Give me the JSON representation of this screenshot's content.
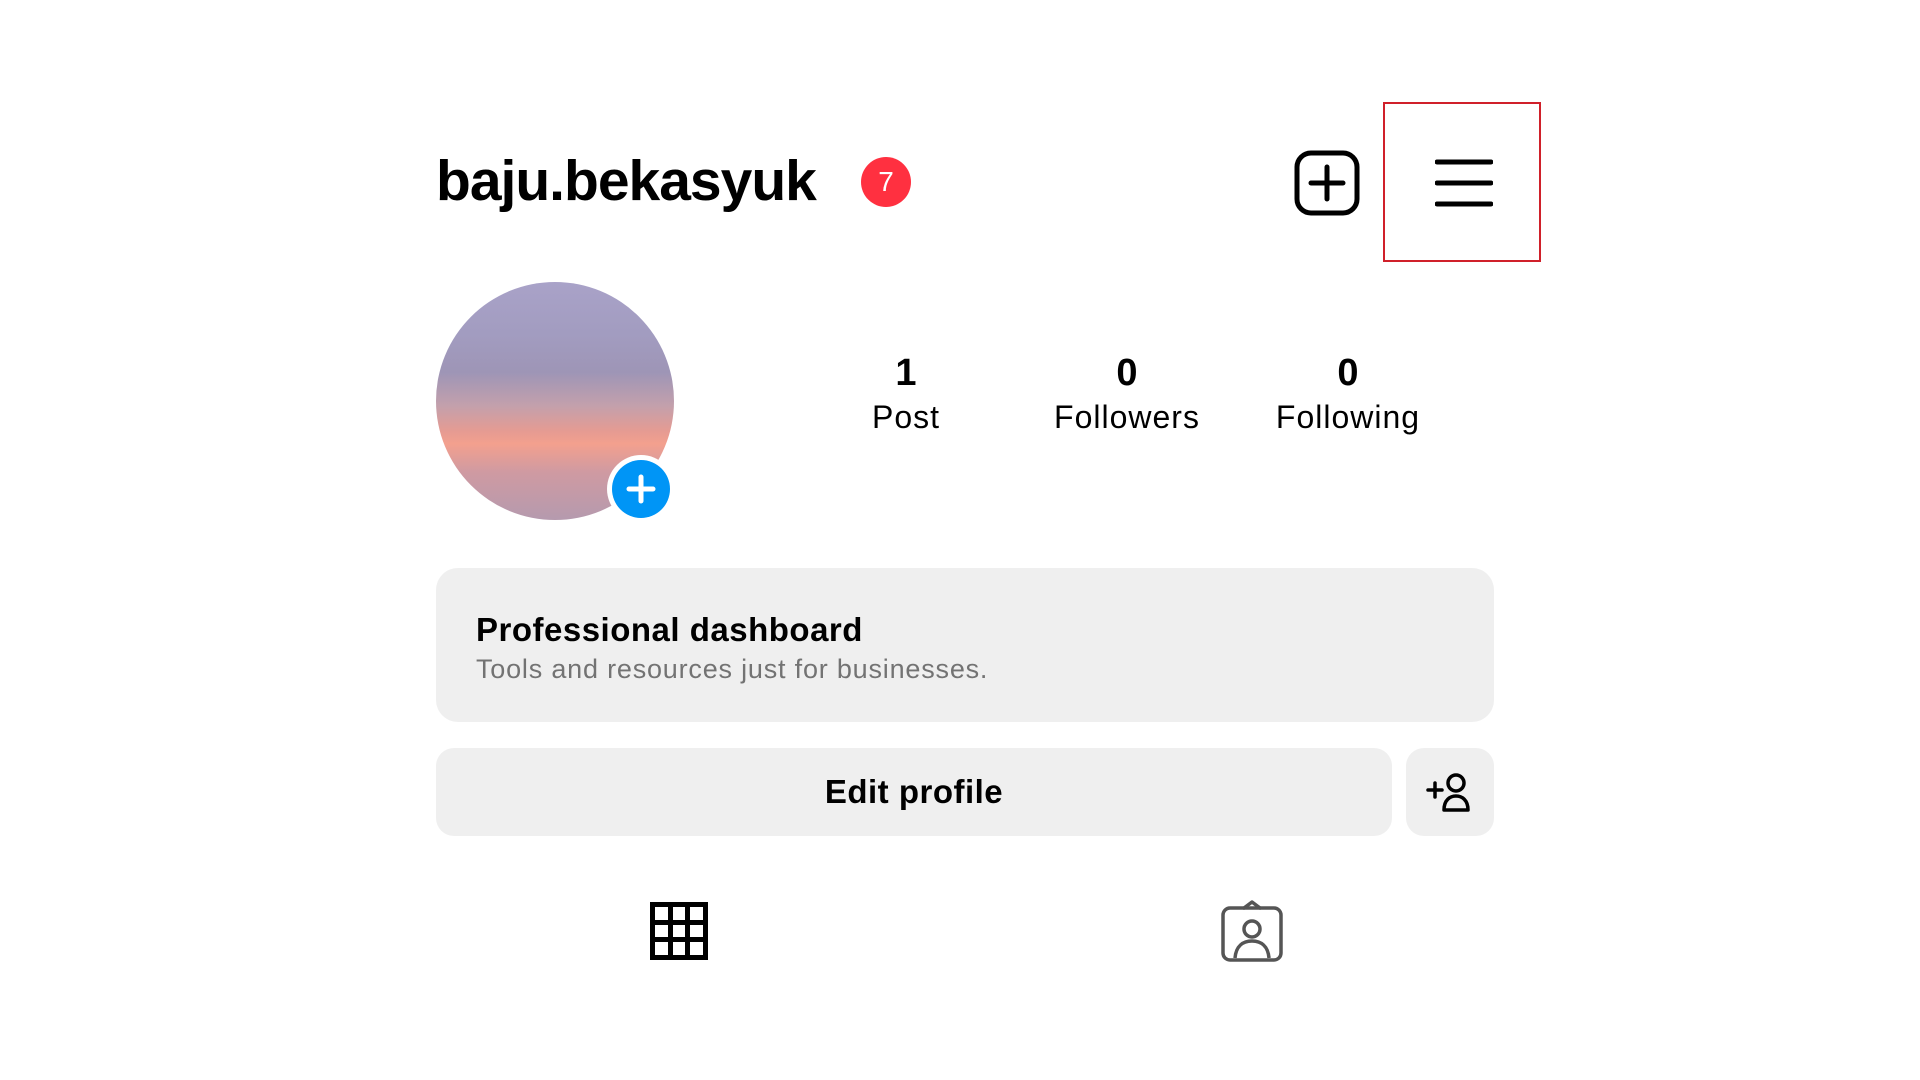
{
  "header": {
    "username": "baju.bekasyuk",
    "notification_count": "7",
    "create_icon": "plus-square-icon",
    "menu_icon": "hamburger-menu-icon"
  },
  "profile": {
    "avatar_icon": "profile-picture",
    "add_story_icon": "plus-icon"
  },
  "stats": {
    "posts_value": "1",
    "posts_label": "Post",
    "followers_value": "0",
    "followers_label": "Followers",
    "following_value": "0",
    "following_label": "Following"
  },
  "dashboard": {
    "title": "Professional dashboard",
    "subtitle": "Tools and resources just for businesses."
  },
  "actions": {
    "edit_profile_label": "Edit profile",
    "add_friend_icon": "add-person-icon"
  },
  "tabs": [
    {
      "icon": "grid-icon"
    },
    {
      "icon": "tagged-user-icon"
    }
  ],
  "colors": {
    "badge": "#ff3040",
    "accent": "#0095f6",
    "button_bg": "#efefef",
    "secondary_text": "#737373",
    "highlight_border": "#d0202a"
  }
}
